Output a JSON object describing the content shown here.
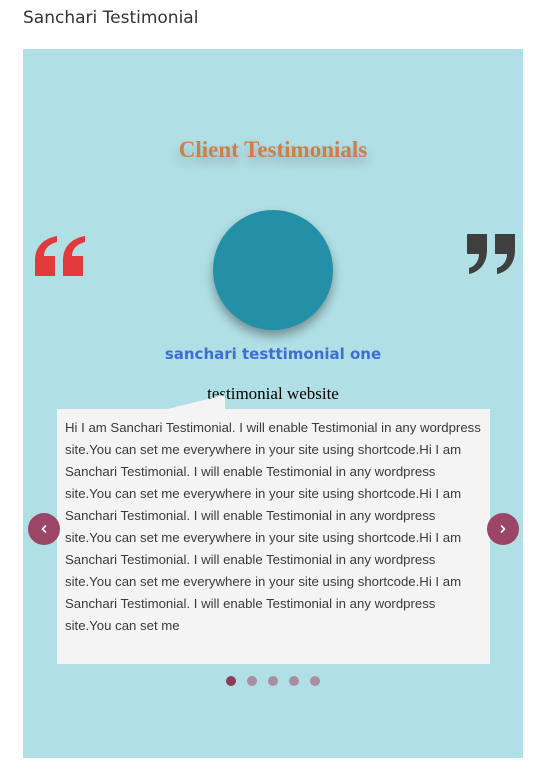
{
  "widget": {
    "title": "Sanchari Testimonial"
  },
  "slider": {
    "heading": "Client Testimonials",
    "client_name": "sanchari testtimonial one",
    "client_website": "testimonial website",
    "testimonial_text": "Hi I am Sanchari Testimonial. I will enable Testimonial in any wordpress site.You can set me everywhere in your site using shortcode.Hi I am Sanchari Testimonial. I will enable Testimonial in any wordpress site.You can set me everywhere in your site using shortcode.Hi I am Sanchari Testimonial. I will enable Testimonial in any wordpress site.You can set me everywhere in your site using shortcode.Hi I am Sanchari Testimonial. I will enable Testimonial in any wordpress site.You can set me everywhere in your site using shortcode.Hi I am Sanchari Testimonial. I will enable Testimonial in any wordpress site.You can set me",
    "prev_icon": "chevron-left-icon",
    "next_icon": "chevron-right-icon",
    "dots_count": 5,
    "active_dot": 1
  },
  "colors": {
    "background": "#b0dfe5",
    "heading": "#cc7f49",
    "avatar": "#2490a8",
    "client_name": "#3b6fd6",
    "quote_left": "#e03a3a",
    "quote_right": "#3f3f3f",
    "nav_button": "#9c4566",
    "dot_active": "#8e3b5a",
    "dot_inactive": "#a88ea0",
    "bubble": "#f4f4f4"
  }
}
